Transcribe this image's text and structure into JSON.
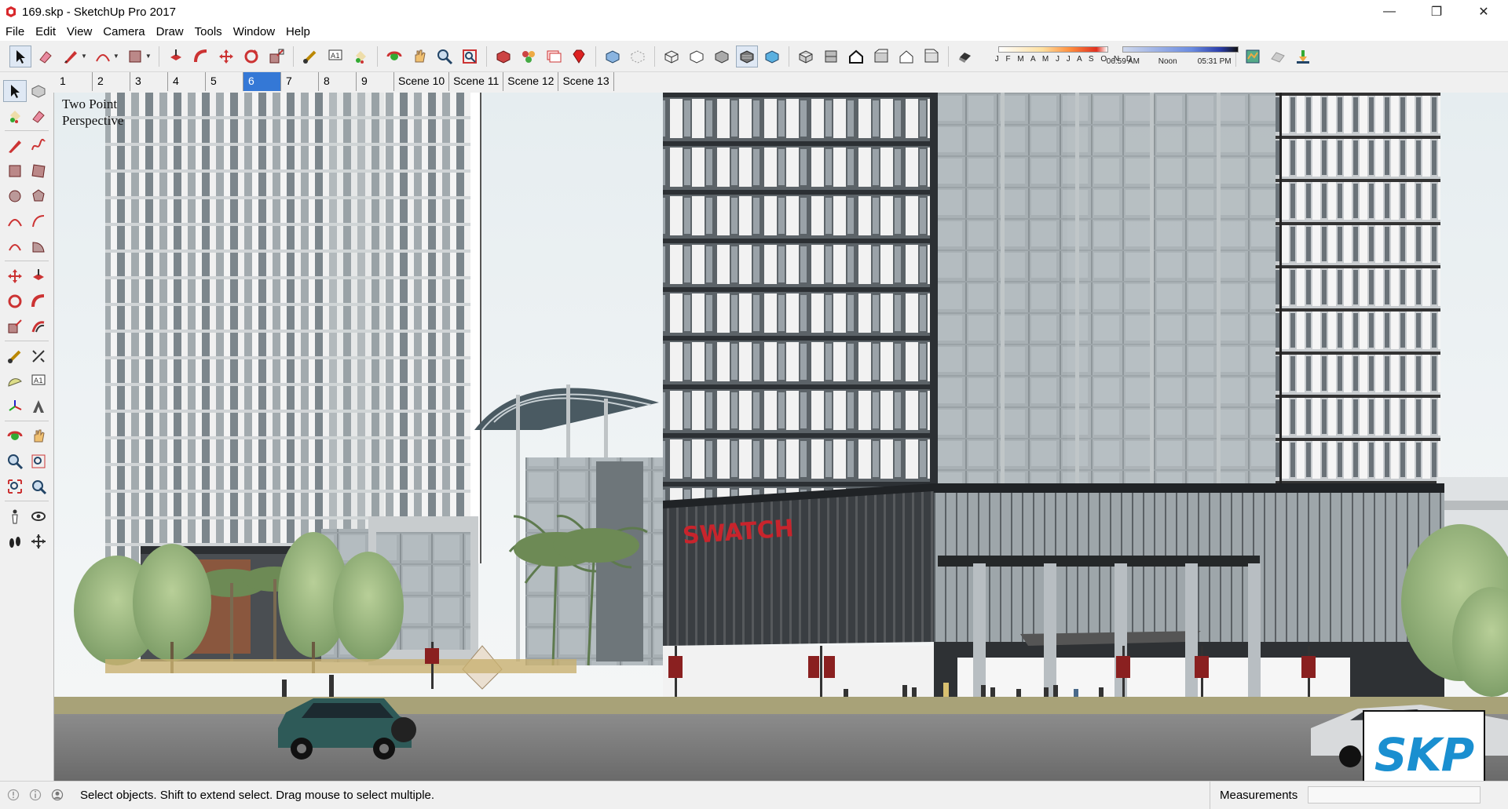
{
  "window": {
    "title": "169.skp - SketchUp Pro 2017",
    "minimize_glyph": "—",
    "maximize_glyph": "❐",
    "close_glyph": "✕"
  },
  "menu": [
    "File",
    "Edit",
    "View",
    "Camera",
    "Draw",
    "Tools",
    "Window",
    "Help"
  ],
  "toolbar": {
    "icons": [
      "select-arrow-icon",
      "eraser-icon",
      "pencil-line-icon",
      "arc-icon",
      "rectangle-icon",
      "push-pull-icon",
      "follow-me-icon",
      "move-icon",
      "rotate-icon",
      "scale-icon",
      "tape-measure-icon",
      "text-icon",
      "paint-bucket-icon",
      "orbit-icon",
      "pan-icon",
      "zoom-icon",
      "zoom-extents-icon",
      "components-icon",
      "materials-icon",
      "styles-icon",
      "ruby-icon",
      "xray-icon",
      "back-edges-icon",
      "wireframe-icon",
      "hidden-line-icon",
      "shaded-icon",
      "shaded-textures-icon",
      "monochrome-icon",
      "iso-view-icon",
      "top-view-icon",
      "front-view-icon",
      "right-view-icon",
      "back-view-icon",
      "left-view-icon",
      "shadows-icon",
      "add-location-icon",
      "toggle-terrain-icon",
      "photo-textures-icon"
    ],
    "shadow_months": "J F M A M J J A S O N D",
    "shadow_time_start": "06:59 AM",
    "shadow_time_noon": "Noon",
    "shadow_time_end": "05:31 PM"
  },
  "scene_tabs": [
    "1",
    "2",
    "3",
    "4",
    "5",
    "6",
    "7",
    "8",
    "9",
    "Scene 10",
    "Scene 11",
    "Scene 12",
    "Scene 13"
  ],
  "active_scene": "6",
  "left_tools": [
    "select-icon",
    "make-component-icon",
    "paint-bucket-icon",
    "eraser-icon",
    "line-icon",
    "freehand-icon",
    "rectangle-icon",
    "rotated-rectangle-icon",
    "circle-icon",
    "polygon-icon",
    "arc-icon",
    "two-point-arc-icon",
    "three-point-arc-icon",
    "pie-icon",
    "move-icon",
    "push-pull-icon",
    "rotate-icon",
    "follow-me-icon",
    "scale-icon",
    "offset-icon",
    "tape-measure-icon",
    "dimension-icon",
    "protractor-icon",
    "text-icon",
    "axes-icon",
    "3d-text-icon",
    "orbit-icon",
    "pan-icon",
    "zoom-icon",
    "zoom-window-icon",
    "zoom-extents-icon",
    "previous-view-icon",
    "position-camera-icon",
    "look-around-icon",
    "walk-icon",
    "section-plane-icon"
  ],
  "viewport": {
    "camera_label_line1": "Two Point",
    "camera_label_line2": "Perspective",
    "sign_text": "SWATCH"
  },
  "badge": {
    "text": "SKP"
  },
  "status": {
    "message": "Select objects. Shift to extend select. Drag mouse to select multiple.",
    "measurements_label": "Measurements"
  },
  "colors": {
    "accent_blue": "#3478d6",
    "sign_red": "#c8242c",
    "skp_blue": "#1a8fd0"
  }
}
